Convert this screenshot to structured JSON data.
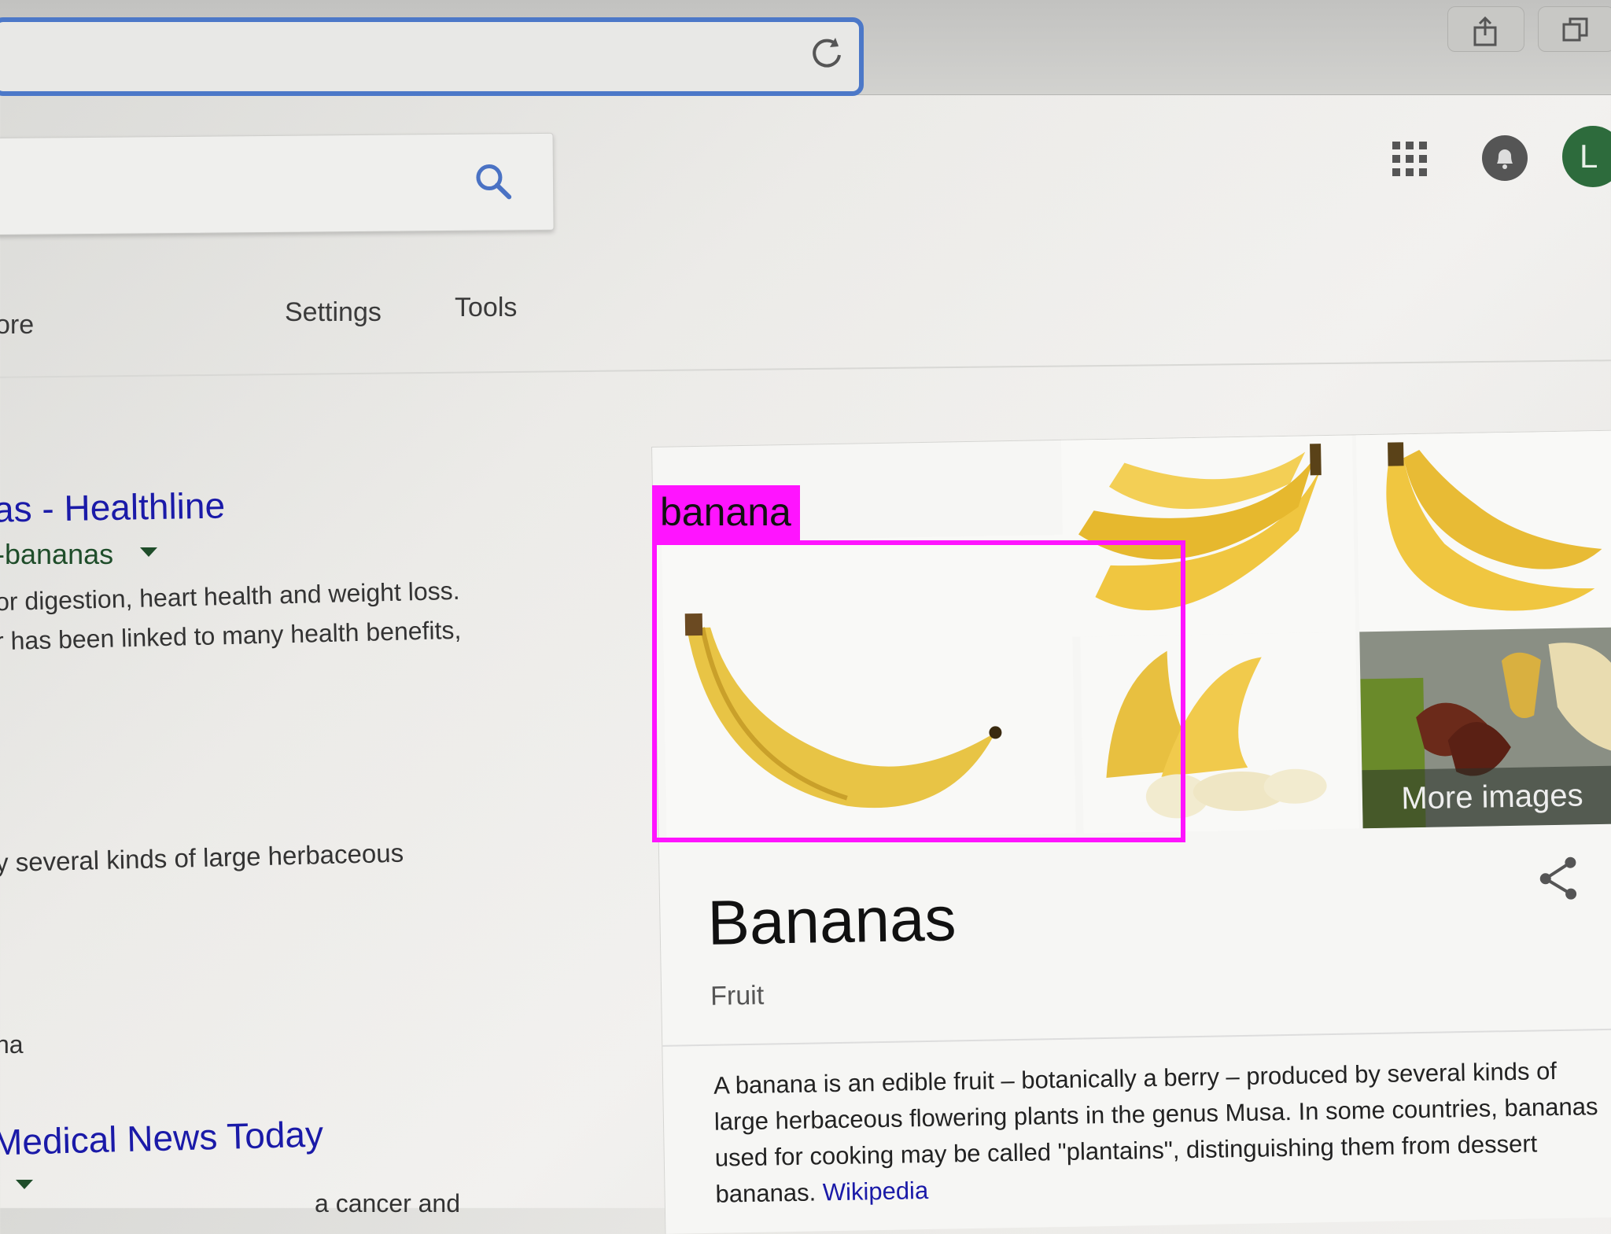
{
  "search": {
    "placeholder": ""
  },
  "nav": {
    "more_partial": "ore",
    "settings": "Settings",
    "tools": "Tools"
  },
  "results": [
    {
      "title": "as - Healthline",
      "url": "-bananas",
      "snippet_line1": "or digestion, heart health and weight loss.",
      "snippet_line2": "r has been linked to many health benefits,"
    }
  ],
  "snippets": {
    "herbaceous": "y several kinds of large herbaceous",
    "na": "na"
  },
  "result2": {
    "title": "Medical News Today",
    "snippet": "a cancer and"
  },
  "avatar_letter": "L",
  "knowledge_panel": {
    "more_images": "More images",
    "title": "Bananas",
    "subtitle": "Fruit",
    "description": "A banana is an edible fruit – botanically a berry – produced by several kinds of large herbaceous flowering plants in the genus Musa. In some countries, bananas used for cooking may be called \"plantains\", distinguishing them from dessert bananas.",
    "source_link": "Wikipedia"
  },
  "detection": {
    "label": "banana",
    "color": "#ff14ff"
  },
  "colors": {
    "link_blue": "#1a1aa8",
    "url_green": "#1f4d2a",
    "highlight_magenta": "#ff14ff",
    "url_field_border": "#4c78c8"
  },
  "icons": [
    "reload-icon",
    "share-icon",
    "tabs-icon",
    "search-icon",
    "apps-grid-icon",
    "notifications-icon",
    "dropdown-arrow-icon",
    "share-icon"
  ]
}
